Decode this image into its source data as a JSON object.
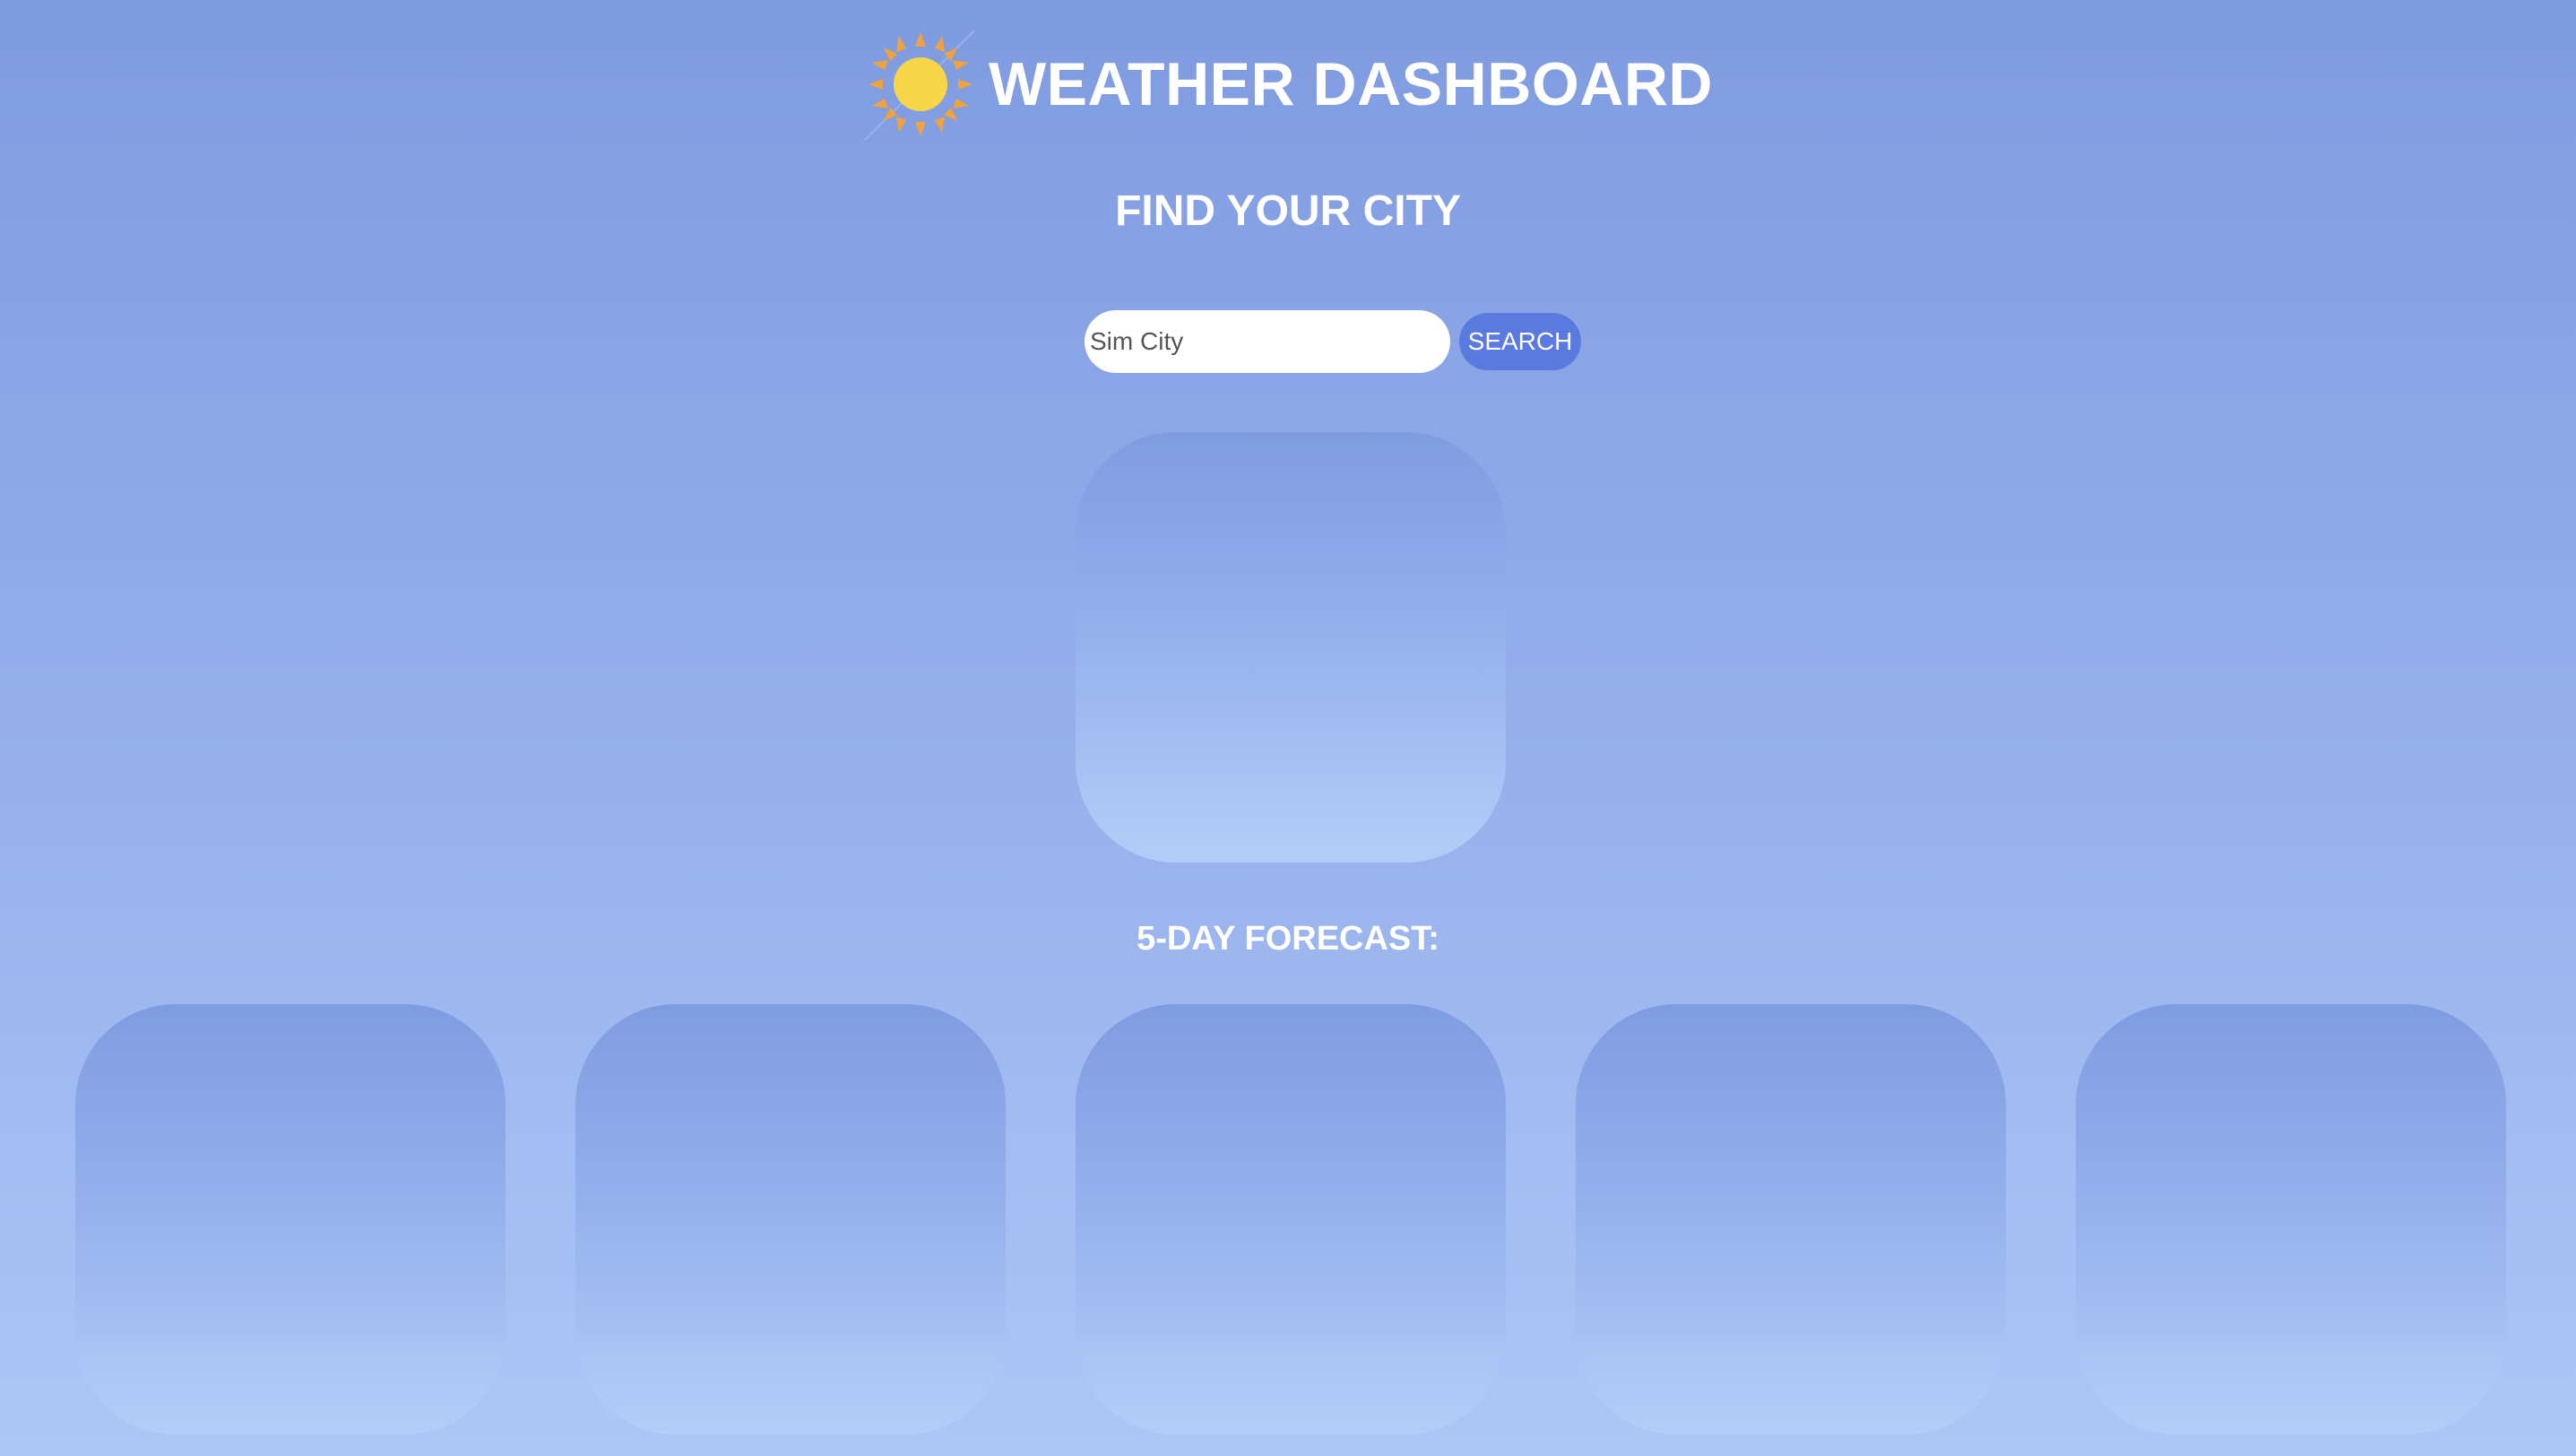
{
  "header": {
    "title": "WEATHER DASHBOARD",
    "logo_icon": "sun-icon",
    "sun_color": "#f6d548",
    "ray_color": "#f0a23c"
  },
  "search": {
    "heading": "FIND YOUR CITY",
    "placeholder": "Sim City",
    "value": "",
    "button_label": "SEARCH",
    "button_color": "#5b7ae0"
  },
  "current_weather": {
    "content": ""
  },
  "forecast": {
    "heading": "5-DAY FORECAST:",
    "days": [
      {
        "content": ""
      },
      {
        "content": ""
      },
      {
        "content": ""
      },
      {
        "content": ""
      },
      {
        "content": ""
      }
    ]
  },
  "colors": {
    "background_top": "#7f9be0",
    "background_bottom": "#adc6f7",
    "card_top": "#809ce1",
    "card_bottom": "#b3cdf9",
    "text": "#ffffff"
  }
}
